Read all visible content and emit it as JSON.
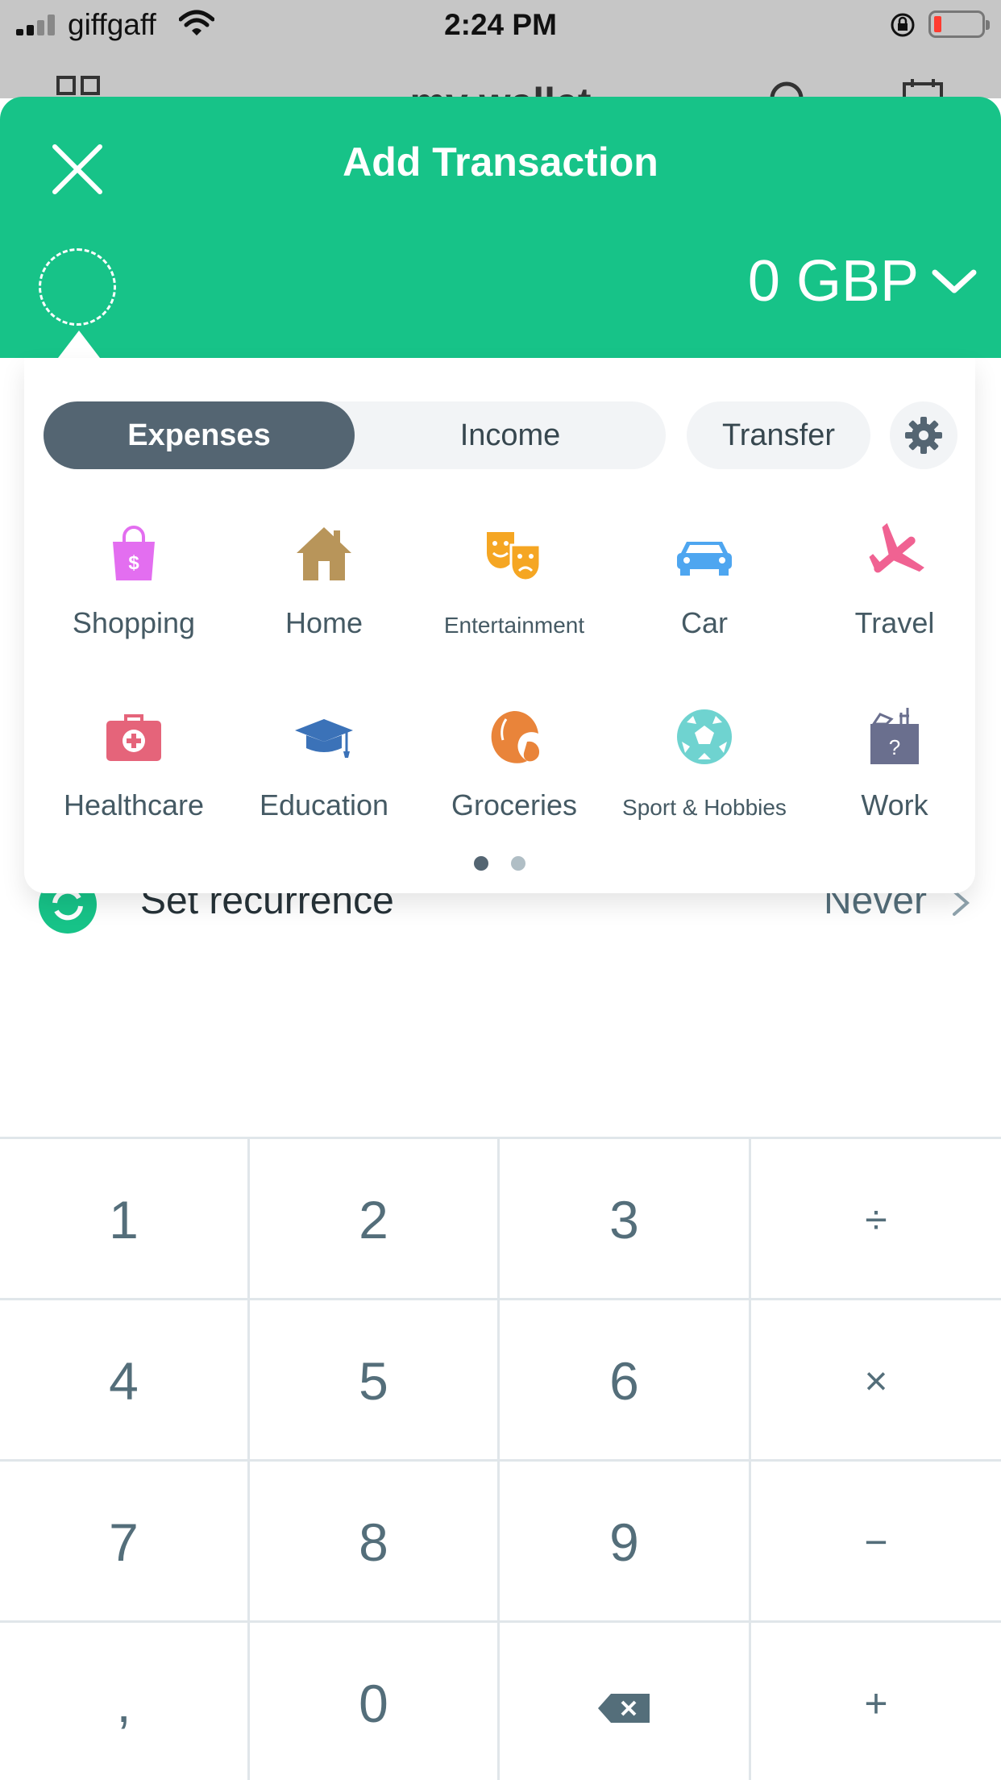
{
  "status_bar": {
    "carrier": "giffgaff",
    "time": "2:24 PM"
  },
  "background_app": {
    "title": "my wallet"
  },
  "header": {
    "title": "Add Transaction",
    "amount": "0 GBP"
  },
  "tabs": {
    "expenses": "Expenses",
    "income": "Income",
    "transfer": "Transfer"
  },
  "categories": [
    {
      "label": "Shopping",
      "icon": "shopping-bag-icon",
      "color": "#e36ef0"
    },
    {
      "label": "Home",
      "icon": "house-icon",
      "color": "#b8955a"
    },
    {
      "label": "Entertainment",
      "icon": "theater-masks-icon",
      "color": "#f5a623"
    },
    {
      "label": "Car",
      "icon": "car-icon",
      "color": "#4ea6f0"
    },
    {
      "label": "Travel",
      "icon": "airplane-icon",
      "color": "#f06292"
    },
    {
      "label": "Healthcare",
      "icon": "first-aid-kit-icon",
      "color": "#e5647a"
    },
    {
      "label": "Education",
      "icon": "graduation-cap-icon",
      "color": "#3b72b8"
    },
    {
      "label": "Groceries",
      "icon": "croissant-icon",
      "color": "#e9843a"
    },
    {
      "label": "Sport & Hobbies",
      "icon": "soccer-ball-icon",
      "color": "#6fd3d0"
    },
    {
      "label": "Work",
      "icon": "toolbox-icon",
      "color": "#6a6f8e"
    }
  ],
  "recurrence": {
    "label": "Set recurrence",
    "value": "Never"
  },
  "keypad": {
    "rows": [
      [
        "1",
        "2",
        "3",
        "÷"
      ],
      [
        "4",
        "5",
        "6",
        "×"
      ],
      [
        "7",
        "8",
        "9",
        "−"
      ],
      [
        ",",
        "0",
        "⌫",
        "+"
      ]
    ]
  },
  "colors": {
    "brand_green": "#17c388",
    "active_tab": "#546572",
    "text_gray": "#546e7a"
  }
}
